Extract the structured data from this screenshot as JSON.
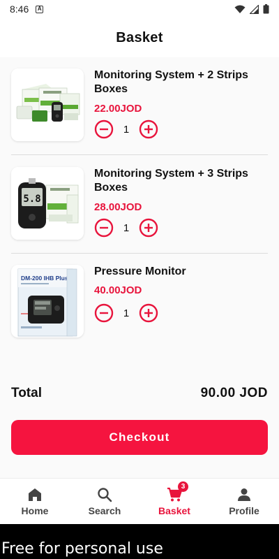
{
  "status_bar": {
    "time": "8:46",
    "notification_badge": "A"
  },
  "header": {
    "title": "Basket"
  },
  "items": [
    {
      "name": "Monitoring System + 2 Strips Boxes",
      "price": "22.00JOD",
      "quantity": "1",
      "image_icon": "glucose-kit-2-strips-image"
    },
    {
      "name": "Monitoring System + 3 Strips Boxes",
      "price": "28.00JOD",
      "quantity": "1",
      "image_icon": "glucose-kit-3-strips-image",
      "meter_reading": "5.8"
    },
    {
      "name": "Pressure Monitor",
      "price": "40.00JOD",
      "quantity": "1",
      "image_icon": "pressure-monitor-image",
      "box_label": "DM-200 IHB Plus"
    }
  ],
  "summary": {
    "total_label": "Total",
    "total_value": "90.00 JOD"
  },
  "checkout": {
    "label": "Checkout"
  },
  "nav": {
    "items": [
      {
        "label": "Home",
        "icon": "home-icon"
      },
      {
        "label": "Search",
        "icon": "search-icon"
      },
      {
        "label": "Basket",
        "icon": "cart-icon",
        "badge": "3",
        "active": true
      },
      {
        "label": "Profile",
        "icon": "person-icon"
      }
    ]
  },
  "watermark": "Free for personal use",
  "colors": {
    "accent": "#e8143c",
    "button": "#f5143f",
    "background": "#fafafa"
  }
}
